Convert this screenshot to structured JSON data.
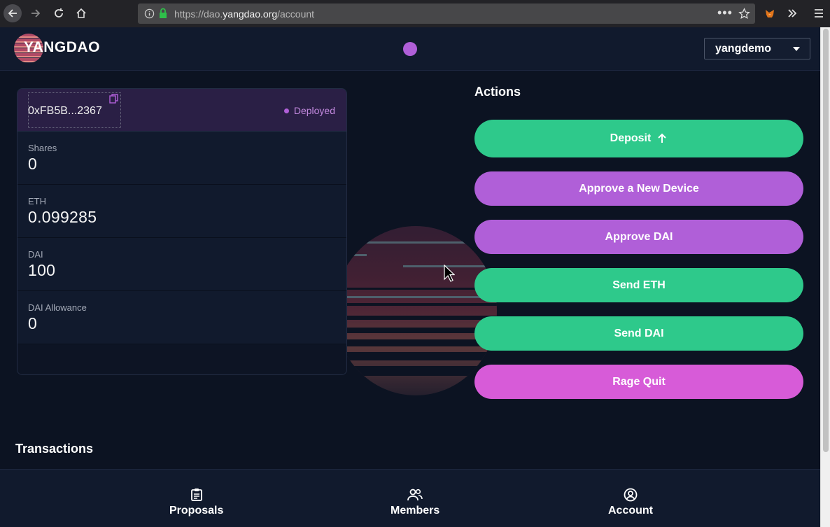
{
  "browser": {
    "url_prefix": "https://dao.",
    "url_domain": "yangdao.org",
    "url_path": "/account",
    "icons": [
      "back-arrow-icon",
      "forward-arrow-icon",
      "reload-icon",
      "home-icon",
      "info-icon",
      "lock-icon",
      "more-icon",
      "star-icon",
      "metamask-fox-icon",
      "overflow-icon",
      "menu-icon"
    ]
  },
  "header": {
    "logo_text": "YANGDAO",
    "user_selected": "yangdemo"
  },
  "account": {
    "address": "0xFB5B...2367",
    "status": "Deployed",
    "stats": [
      {
        "label": "Shares",
        "value": "0"
      },
      {
        "label": "ETH",
        "value": "0.099285"
      },
      {
        "label": "DAI",
        "value": "100"
      },
      {
        "label": "DAI Allowance",
        "value": "0"
      }
    ]
  },
  "actions": {
    "title": "Actions",
    "buttons": [
      {
        "label": "Deposit"
      },
      {
        "label": "Approve a New Device"
      },
      {
        "label": "Approve DAI"
      },
      {
        "label": "Send ETH"
      },
      {
        "label": "Send DAI"
      },
      {
        "label": "Rage Quit"
      }
    ]
  },
  "transactions": {
    "title": "Transactions"
  },
  "nav": {
    "items": [
      {
        "label": "Proposals"
      },
      {
        "label": "Members"
      },
      {
        "label": "Account"
      }
    ]
  },
  "colors": {
    "green": "#2ec98b",
    "purple": "#b05fd8",
    "magenta": "#d75bd8",
    "background": "#0c1322"
  }
}
